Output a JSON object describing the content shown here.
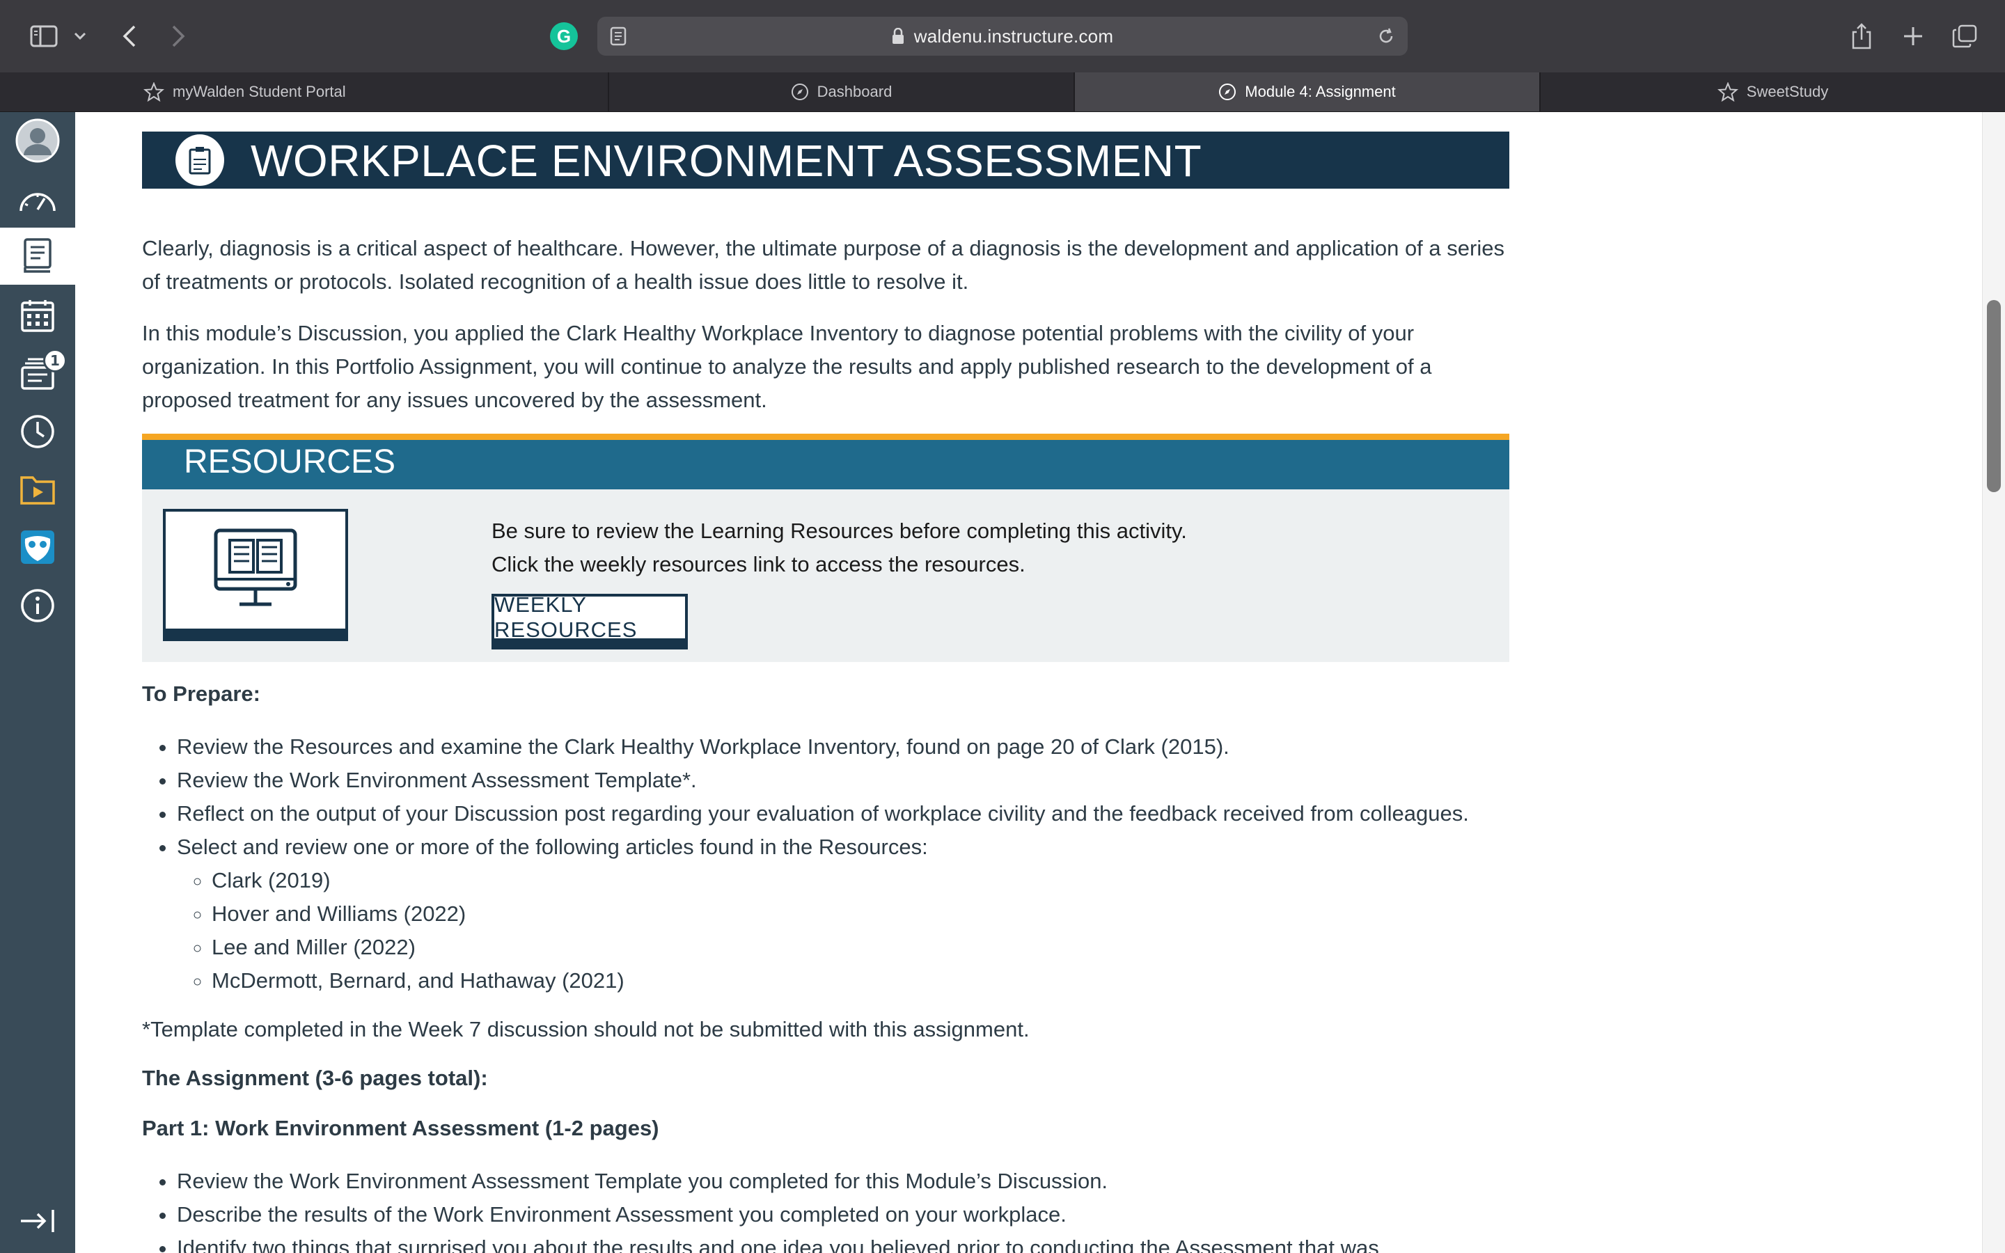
{
  "browser": {
    "url": "waldenu.instructure.com",
    "tabs": [
      {
        "label": "myWalden Student Portal",
        "icon": "star-icon"
      },
      {
        "label": "Dashboard",
        "icon": "compass-icon"
      },
      {
        "label": "Module 4: Assignment",
        "icon": "compass-icon",
        "active": true
      },
      {
        "label": "SweetStudy",
        "icon": "star-icon"
      }
    ],
    "grammarly_label": "G"
  },
  "nav": {
    "inbox_badge": "1"
  },
  "page": {
    "banner_title": "WORKPLACE ENVIRONMENT ASSESSMENT",
    "intro_p1": "Clearly, diagnosis is a critical aspect of healthcare. However, the ultimate purpose of a diagnosis is the development and application of a series of treatments or protocols. Isolated recognition of a health issue does little to resolve it.",
    "intro_p2": "In this module’s Discussion, you applied the Clark Healthy Workplace Inventory to diagnose potential problems with the civility of your organization. In this Portfolio Assignment, you will continue to analyze the results and apply published research to the development of a proposed treatment for any issues uncovered by the assessment.",
    "resources": {
      "title": "RESOURCES",
      "line1": "Be sure to review the Learning Resources before completing this activity.",
      "line2": "Click the weekly resources link to access the resources.",
      "button": "WEEKLY RESOURCES"
    },
    "prepare_heading": "To Prepare:",
    "prepare_items": [
      "Review the Resources and examine the Clark Healthy Workplace Inventory, found on page 20 of Clark (2015).",
      "Review the Work Environment Assessment Template*.",
      "Reflect on the output of your Discussion post regarding your evaluation of workplace civility and the feedback received from colleagues.",
      "Select and review one or more of the following articles found in the Resources:"
    ],
    "articles": [
      "Clark (2019)",
      "Hover and Williams (2022)",
      "Lee and Miller (2022)",
      "McDermott, Bernard, and Hathaway (2021)"
    ],
    "template_note": "*Template completed in the Week 7 discussion should not be submitted with this assignment.",
    "assignment_heading": "The Assignment (3-6 pages total):",
    "part1_heading": "Part 1: Work Environment Assessment (1-2 pages)",
    "part1_items": [
      "Review the Work Environment Assessment Template you completed for this Module’s Discussion.",
      "Describe the results of the Work Environment Assessment you completed on your workplace.",
      "Identify two things that surprised you about the results and one idea you believed prior to conducting the Assessment that was"
    ]
  }
}
